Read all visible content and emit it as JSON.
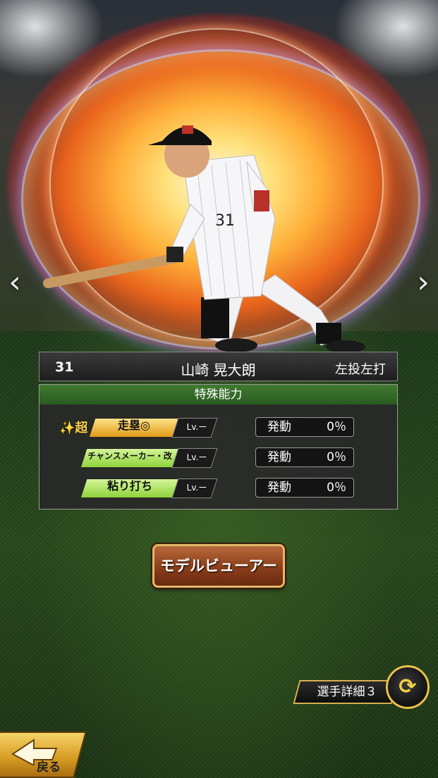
{
  "player": {
    "number": "31",
    "name": "山崎 晃大朗",
    "throw_bat": "左投左打"
  },
  "abilities": {
    "header": "特殊能力",
    "super_mark": "✨超",
    "items": [
      {
        "name": "走塁◎",
        "level": "Lv.ー",
        "activate_label": "発動",
        "activate_value": "0％",
        "color": "#f0b830"
      },
      {
        "name": "チャンスメーカー・改",
        "level": "Lv.ー",
        "activate_label": "発動",
        "activate_value": "0％",
        "color": "#a8e04a"
      },
      {
        "name": "粘り打ち",
        "level": "Lv.ー",
        "activate_label": "発動",
        "activate_value": "0％",
        "color": "#a8e04a"
      }
    ]
  },
  "buttons": {
    "model_viewer": "モデルビューアー",
    "player_detail": "選手詳細３",
    "back": "戻る"
  },
  "nav": {
    "prev": "‹",
    "next": "›"
  },
  "colors": {
    "accent_gold": "#e0b86a",
    "header_green": "#3f7a2f"
  }
}
